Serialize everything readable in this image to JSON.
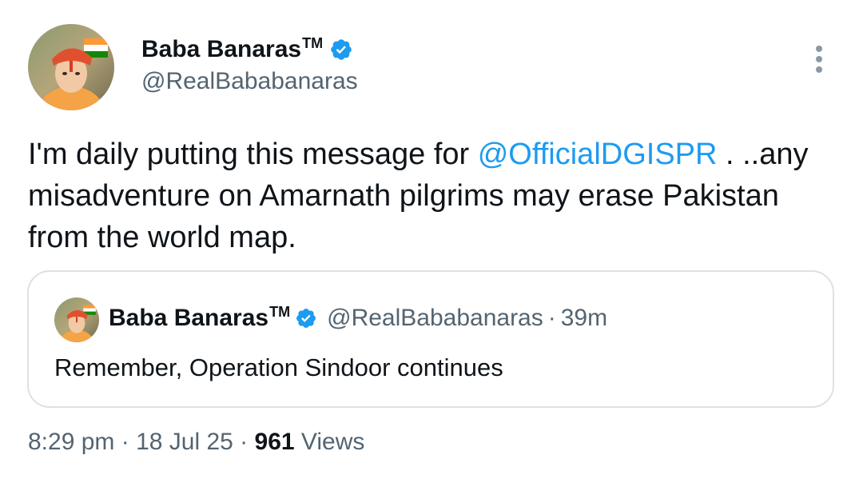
{
  "author": {
    "name": "Baba Banaras",
    "trademark": "TM",
    "handle": "@RealBababanaras",
    "avatar_icon": "profile-avatar"
  },
  "tweet": {
    "text_before": "I'm daily putting this message for ",
    "mention": "@OfficialDGISPR",
    "text_after": " . ..any misadventure on Amarnath pilgrims may erase Pakistan from the world map."
  },
  "quoted_tweet": {
    "name": "Baba Banaras",
    "trademark": "TM",
    "handle": "@RealBababanaras",
    "separator": "·",
    "time": "39m",
    "text": "Remember, Operation Sindoor continues"
  },
  "meta": {
    "time": "8:29 pm",
    "sep1": " · ",
    "date": "18 Jul 25",
    "sep2": " · ",
    "views_count": "961",
    "views_label": " Views"
  },
  "colors": {
    "accent": "#1d9bf0",
    "secondary_text": "#536471",
    "border": "#dbe1e6"
  }
}
